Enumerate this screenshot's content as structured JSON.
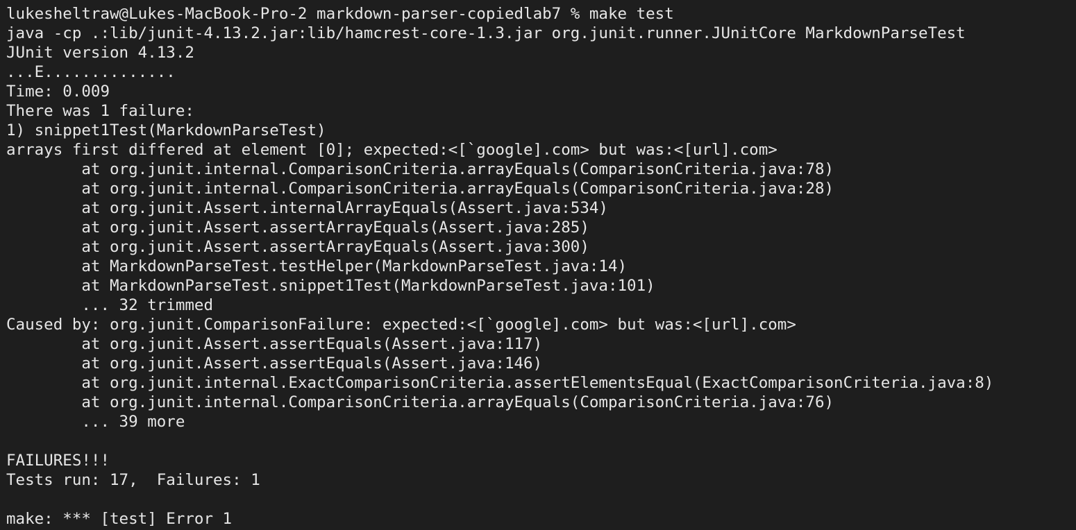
{
  "terminal": {
    "lines": [
      "lukesheltraw@Lukes-MacBook-Pro-2 markdown-parser-copiedlab7 % make test",
      "java -cp .:lib/junit-4.13.2.jar:lib/hamcrest-core-1.3.jar org.junit.runner.JUnitCore MarkdownParseTest",
      "JUnit version 4.13.2",
      "...E..............",
      "Time: 0.009",
      "There was 1 failure:",
      "1) snippet1Test(MarkdownParseTest)",
      "arrays first differed at element [0]; expected:<[`google].com> but was:<[url].com>",
      "        at org.junit.internal.ComparisonCriteria.arrayEquals(ComparisonCriteria.java:78)",
      "        at org.junit.internal.ComparisonCriteria.arrayEquals(ComparisonCriteria.java:28)",
      "        at org.junit.Assert.internalArrayEquals(Assert.java:534)",
      "        at org.junit.Assert.assertArrayEquals(Assert.java:285)",
      "        at org.junit.Assert.assertArrayEquals(Assert.java:300)",
      "        at MarkdownParseTest.testHelper(MarkdownParseTest.java:14)",
      "        at MarkdownParseTest.snippet1Test(MarkdownParseTest.java:101)",
      "        ... 32 trimmed",
      "Caused by: org.junit.ComparisonFailure: expected:<[`google].com> but was:<[url].com>",
      "        at org.junit.Assert.assertEquals(Assert.java:117)",
      "        at org.junit.Assert.assertEquals(Assert.java:146)",
      "        at org.junit.internal.ExactComparisonCriteria.assertElementsEqual(ExactComparisonCriteria.java:8)",
      "        at org.junit.internal.ComparisonCriteria.arrayEquals(ComparisonCriteria.java:76)",
      "        ... 39 more",
      "",
      "FAILURES!!!",
      "Tests run: 17,  Failures: 1",
      "",
      "make: *** [test] Error 1"
    ]
  }
}
